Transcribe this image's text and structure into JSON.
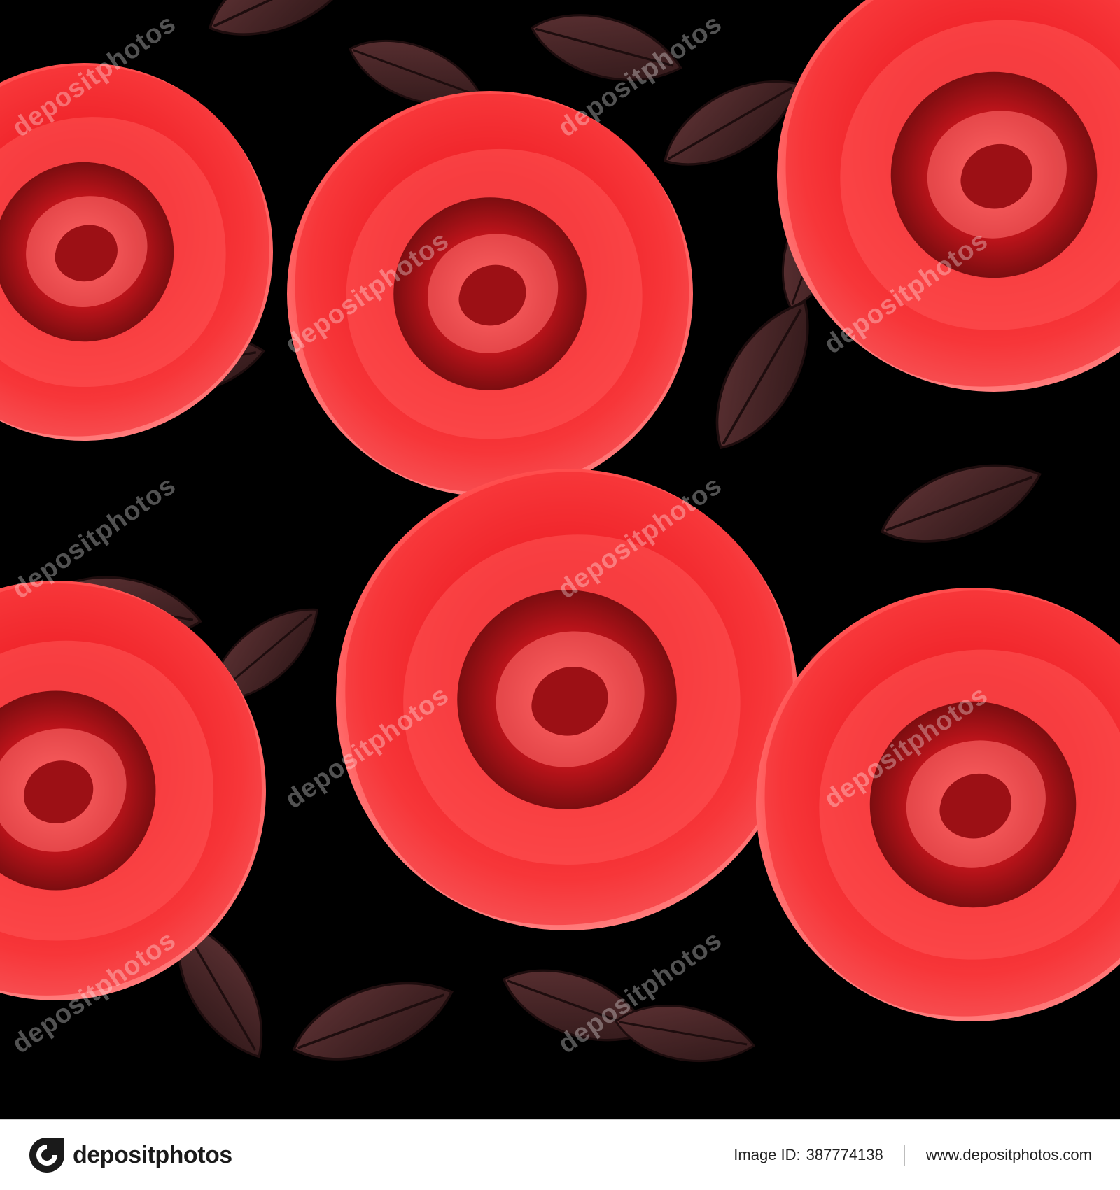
{
  "watermark": {
    "text": "depositphotos"
  },
  "footer": {
    "brand": "depositphotos",
    "image_id_label": "Image ID:",
    "image_id": "387774138",
    "site": "www.depositphotos.com"
  },
  "colors": {
    "background": "#000000",
    "rose_red": "#e8141c",
    "rose_light": "#ff6a6a",
    "rose_dark": "#8a0f12",
    "leaf": "#4e2a2c",
    "leaf_dark": "#2a1516",
    "footer_bg": "#ffffff"
  },
  "icons": {
    "brand_logo": "depositphotos-logo-icon"
  }
}
